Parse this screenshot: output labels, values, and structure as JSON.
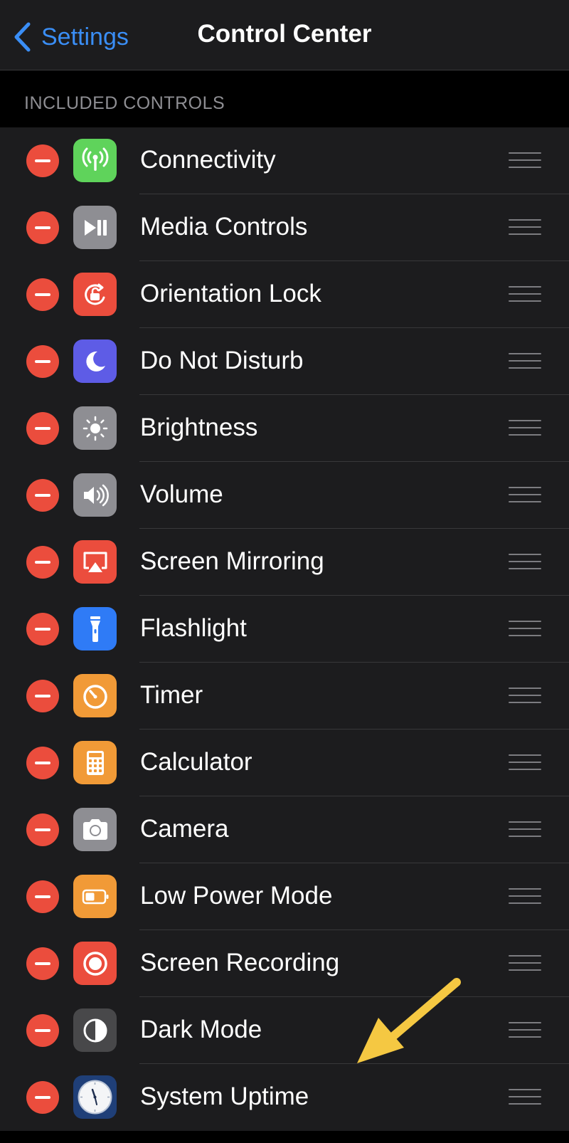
{
  "nav": {
    "back_label": "Settings",
    "title": "Control Center"
  },
  "section": {
    "header": "INCLUDED CONTROLS"
  },
  "controls": [
    {
      "label": "Connectivity",
      "icon": "antenna-icon",
      "color": "#5fd35b"
    },
    {
      "label": "Media Controls",
      "icon": "play-pause-icon",
      "color": "#8e8e93"
    },
    {
      "label": "Orientation Lock",
      "icon": "orientation-lock-icon",
      "color": "#eb4d3d"
    },
    {
      "label": "Do Not Disturb",
      "icon": "moon-icon",
      "color": "#5e5ce6"
    },
    {
      "label": "Brightness",
      "icon": "sun-icon",
      "color": "#8e8e93"
    },
    {
      "label": "Volume",
      "icon": "speaker-icon",
      "color": "#8e8e93"
    },
    {
      "label": "Screen Mirroring",
      "icon": "airplay-icon",
      "color": "#eb4d3d"
    },
    {
      "label": "Flashlight",
      "icon": "flashlight-icon",
      "color": "#2f7bf6"
    },
    {
      "label": "Timer",
      "icon": "timer-icon",
      "color": "#f19a37"
    },
    {
      "label": "Calculator",
      "icon": "calculator-icon",
      "color": "#f19a37"
    },
    {
      "label": "Camera",
      "icon": "camera-icon",
      "color": "#8e8e93"
    },
    {
      "label": "Low Power Mode",
      "icon": "battery-icon",
      "color": "#f19a37"
    },
    {
      "label": "Screen Recording",
      "icon": "record-icon",
      "color": "#eb4d3d"
    },
    {
      "label": "Dark Mode",
      "icon": "dark-mode-icon",
      "color": "#48484a"
    },
    {
      "label": "System Uptime",
      "icon": "clock-icon",
      "color": "#1f3f78"
    }
  ],
  "colors": {
    "accent": "#3a8ef6",
    "remove": "#eb4d3d",
    "annotation_arrow": "#f5c842"
  }
}
